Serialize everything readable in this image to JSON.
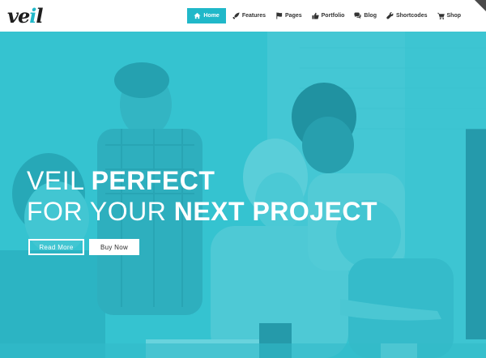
{
  "header": {
    "logo_main": "ve",
    "logo_accent": "i",
    "logo_end": "l",
    "nav": [
      {
        "label": "Home",
        "icon": "home-icon",
        "active": true
      },
      {
        "label": "Features",
        "icon": "rocket-icon",
        "active": false
      },
      {
        "label": "Pages",
        "icon": "flag-icon",
        "active": false
      },
      {
        "label": "Portfolio",
        "icon": "thumbs-up-icon",
        "active": false
      },
      {
        "label": "Blog",
        "icon": "comments-icon",
        "active": false
      },
      {
        "label": "Shortcodes",
        "icon": "wrench-icon",
        "active": false
      },
      {
        "label": "Shop",
        "icon": "cart-icon",
        "active": false
      }
    ]
  },
  "hero": {
    "line1_light": "VEIL ",
    "line1_bold": "PERFECT",
    "line2_light": "FOR YOUR ",
    "line2_bold": "NEXT PROJECT",
    "button_primary": "Read More",
    "button_secondary": "Buy Now"
  },
  "colors": {
    "accent": "#20b8c9",
    "overlay": "#20becd",
    "header_bg": "#ffffff"
  }
}
